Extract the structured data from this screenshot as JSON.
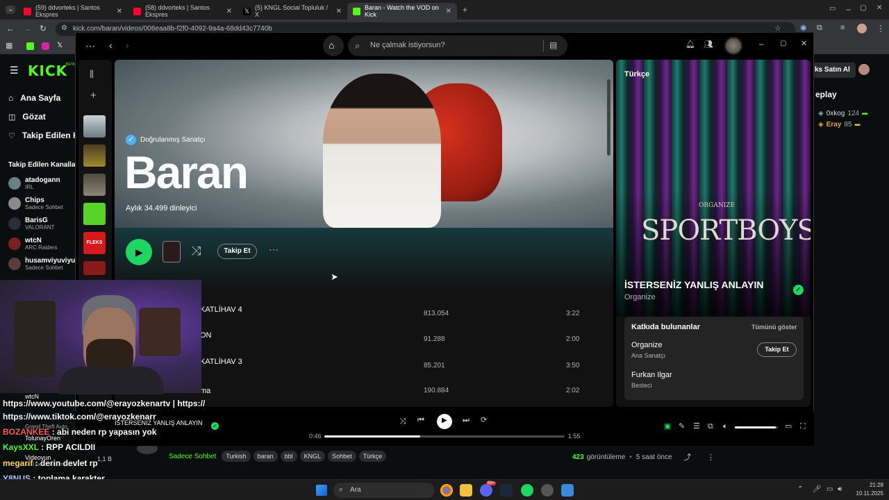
{
  "browser": {
    "tabs": [
      {
        "title": "(59) ddvorteks | Santos Ekspres",
        "color": "#ff0033"
      },
      {
        "title": "(58) ddvorteks | Santos Ekspres",
        "color": "#ff0033"
      },
      {
        "title": "(5) KNGL Social Topluluk / X",
        "color": "#ffffff"
      },
      {
        "title": "Baran - Watch the VOD on Kick",
        "color": "#53fc18"
      }
    ],
    "url": "kick.com/baran/videos/006eaa8b-f2f0-4092-9a4a-68dd43c7740b"
  },
  "kick": {
    "logo": "KICK",
    "logo_badge": "BETA",
    "nav": [
      "Ana Sayfa",
      "Gözat",
      "Takip Edilen K"
    ],
    "followed_header": "Takip Edilen Kanallar",
    "channels": [
      {
        "name": "atadogann",
        "sub": "IRL"
      },
      {
        "name": "Chips",
        "sub": "Sadece Sohbet"
      },
      {
        "name": "BarisG",
        "sub": "VALORANT"
      },
      {
        "name": "wtcN",
        "sub": "ARC Raiders"
      },
      {
        "name": "husamviyuviyu",
        "sub": "Sadece Sohbet"
      }
    ],
    "hidden_channels": [
      {
        "name": "wtcN",
        "sub": "Grand Theft Auto"
      },
      {
        "name": "TolunayOren",
        "sub": ""
      },
      {
        "name": "Videoyun",
        "sub": "Red Dead Redemption 2",
        "count": "1,1 B"
      }
    ],
    "right_btn": "ks Satın Al",
    "right_header": "eplay",
    "leaderboard": [
      {
        "name": "0xkog",
        "score": "124"
      },
      {
        "name": "Eray",
        "score": "85"
      }
    ],
    "tags": [
      "Sadece Sohbet",
      "Turkish",
      "baran",
      "bbl",
      "KNGL",
      "Sohbet",
      "Türkçe"
    ],
    "views": "423",
    "views_label": "görüntüleme",
    "time_ago": "5 saat önce"
  },
  "spotify": {
    "search_placeholder": "Ne çalmak istiyorsun?",
    "verified": "Doğrulanmış Sanatçı",
    "artist": "Baran",
    "listeners": "Aylık 34.499 dinleyici",
    "follow_label": "Takip Et",
    "tracks": [
      {
        "title": "KATLİHAV 4",
        "plays": "813.054",
        "duration": "3:22"
      },
      {
        "title": "ON",
        "plays": "91.288",
        "duration": "2:00"
      },
      {
        "title": "KATLİHAV 3",
        "plays": "85.201",
        "duration": "3:50"
      },
      {
        "title": "ma",
        "plays": "190.884",
        "duration": "2:02"
      }
    ],
    "right_panel": {
      "playlist": "Türkçe",
      "cover_text": "SPORTBOYS",
      "cover_sub": "ORGANIZE",
      "song": "İSTERSENİZ YANLIŞ ANLAYIN",
      "artist": "Organize",
      "credits_title": "Katkıda bulunanlar",
      "show_all": "Tümünü göster",
      "credits": [
        {
          "name": "Organize",
          "role": "Ana Sanatçı"
        },
        {
          "name": "Furkan Ilgar",
          "role": "Besteci"
        }
      ],
      "credits_follow": "Takip Et"
    },
    "now_playing": {
      "title": "İSTERSENİZ YANLIŞ ANLAYIN",
      "elapsed": "0:46",
      "total": "1:55",
      "progress": 0.4,
      "volume": 0.95
    }
  },
  "stream_overlay": {
    "chat": [
      {
        "user": "",
        "text": "https://www.youtube.com/@erayozkenartv | https://",
        "color": "#ffffff"
      },
      {
        "user": "",
        "text": "https://www.tiktok.com/@erayozkenarr",
        "color": "#ffffff"
      },
      {
        "user": "BOZANKEE",
        "text": ": abi neden rp yapasın yok",
        "color": "#ff5a5a"
      },
      {
        "user": "KaysXXL",
        "text": ": RPP ACILDII",
        "color": "#53fc18"
      },
      {
        "user": "megarif",
        "text": ": derin devlet rp",
        "color": "#ffd84a"
      },
      {
        "user": "Y8NUS",
        "text": ": toplama karakter",
        "color": "#b0c8ff"
      },
      {
        "user": "mario99lemina",
        "text": ":",
        "color": "#ffffff"
      }
    ]
  },
  "taskbar": {
    "search": "Ara",
    "time": "21:28",
    "date": "10.11.2025",
    "badge": "99+"
  }
}
